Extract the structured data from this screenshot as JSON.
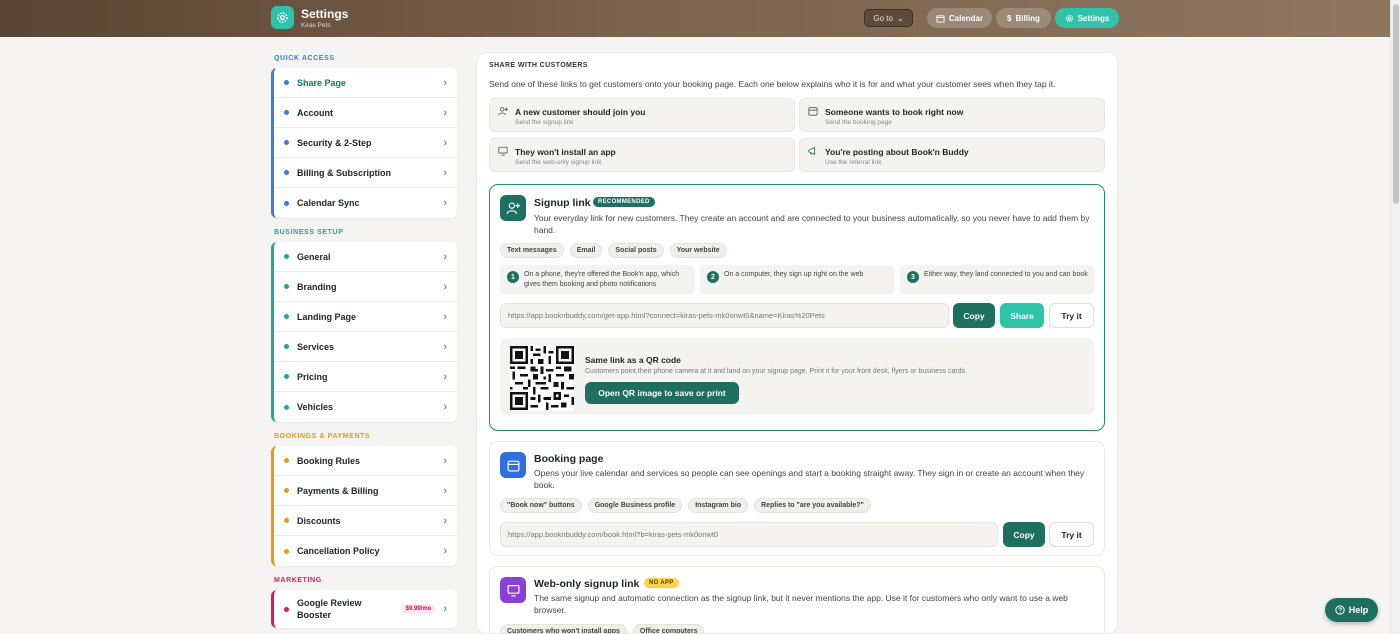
{
  "header": {
    "title": "Settings",
    "subtitle": "Kiras Pets",
    "goto_label": "Go to",
    "nav": [
      {
        "label": "Calendar",
        "icon": "calendar-icon"
      },
      {
        "label": "Billing",
        "icon": "dollar-icon"
      },
      {
        "label": "Settings",
        "icon": "gear-icon"
      }
    ]
  },
  "sidebar": {
    "quick_access": {
      "title": "QUICK ACCESS",
      "color": "#3b7ddd",
      "items": [
        "Share Page",
        "Account",
        "Security & 2-Step",
        "Billing & Subscription",
        "Calendar Sync"
      ]
    },
    "business_setup": {
      "title": "BUSINESS SETUP",
      "color": "#1fa894",
      "items": [
        "General",
        "Branding",
        "Landing Page",
        "Services",
        "Pricing",
        "Vehicles"
      ]
    },
    "bookings_payments": {
      "title": "BOOKINGS & PAYMENTS",
      "color": "#e39a1d",
      "items": [
        "Booking Rules",
        "Payments & Billing",
        "Discounts",
        "Cancellation Policy"
      ]
    },
    "marketing": {
      "title": "MARKETING",
      "color": "#d81b60",
      "items": [
        {
          "label": "Google Review Booster",
          "badge": "$9.99/mo"
        }
      ]
    }
  },
  "main": {
    "heading": "SHARE WITH CUSTOMERS",
    "description": "Send one of these links to get customers onto your booking page. Each one below explains who it is for and what your customer sees when they tap it.",
    "options": [
      {
        "title": "A new customer should join you",
        "sub": "Send the signup link",
        "icon": "user-plus-icon"
      },
      {
        "title": "Someone wants to book right now",
        "sub": "Send the booking page",
        "icon": "calendar-icon"
      },
      {
        "title": "They won't install an app",
        "sub": "Send the web-only signup link",
        "icon": "monitor-icon"
      },
      {
        "title": "You're posting about Book'n Buddy",
        "sub": "Use the referral link",
        "icon": "megaphone-icon"
      }
    ],
    "signup": {
      "title": "Signup link",
      "badge": "RECOMMENDED",
      "description": "Your everyday link for new customers. They create an account and are connected to your business automatically, so you never have to add them by hand.",
      "chips": [
        "Text messages",
        "Email",
        "Social posts",
        "Your website"
      ],
      "steps": [
        {
          "num": "1",
          "text": "On a phone, they're offered the Book'n app, which gives them booking and photo notifications"
        },
        {
          "num": "2",
          "text": "On a computer, they sign up right on the web"
        },
        {
          "num": "3",
          "text": "Either way, they land connected to you and can book"
        }
      ],
      "url": "https://app.booknbuddy.com/get-app.html?connect=kiras-pets-mk0onwt0&name=Kiras%20Pets",
      "copy_label": "Copy",
      "share_label": "Share",
      "try_label": "Try it",
      "qr_title": "Same link as a QR code",
      "qr_desc": "Customers point their phone camera at it and land on your signup page. Print it for your front desk, flyers or business cards.",
      "qr_button": "Open QR image to save or print"
    },
    "booking": {
      "title": "Booking page",
      "description": "Opens your live calendar and services so people can see openings and start a booking straight away. They sign in or create an account when they book.",
      "chips": [
        "\"Book now\" buttons",
        "Google Business profile",
        "Instagram bio",
        "Replies to \"are you available?\""
      ],
      "url": "https://app.booknbuddy.com/book.html?b=kiras-pets-mk0onwt0",
      "copy_label": "Copy",
      "try_label": "Try it"
    },
    "webonly": {
      "title": "Web-only signup link",
      "badge": "NO APP",
      "description": "The same signup and automatic connection as the signup link, but it never mentions the app. Use it for customers who only want to use a web browser.",
      "chips": [
        "Customers who won't install apps",
        "Office computers"
      ]
    }
  },
  "help_label": "Help",
  "colors": {
    "accent": "#2fc3aa",
    "dark_green": "#1e6f60",
    "header_brown": "#6b543f"
  }
}
